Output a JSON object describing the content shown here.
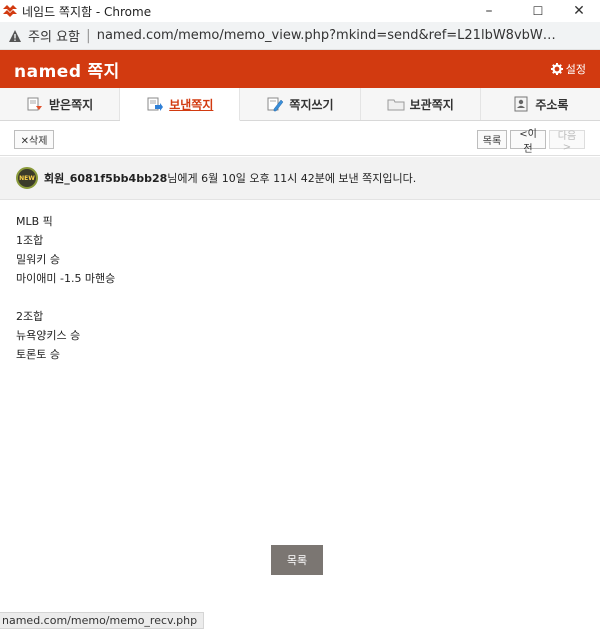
{
  "window": {
    "title": "네임드 쪽지함 - Chrome",
    "minimize": "–",
    "maximize": "☐",
    "close": "✕"
  },
  "addressbar": {
    "warning": "주의 요함",
    "separator": "|",
    "url": "named.com/memo/memo_view.php?mkind=send&ref=L21lbW8vbWVtb19zZW5..."
  },
  "header": {
    "brand": "named",
    "section": "쪽지",
    "settings_label": "설정"
  },
  "tabs": [
    {
      "label": "받은쪽지",
      "icon": "inbox-icon",
      "active": false
    },
    {
      "label": "보낸쪽지",
      "icon": "sent-icon",
      "active": true
    },
    {
      "label": "쪽지쓰기",
      "icon": "compose-icon",
      "active": false
    },
    {
      "label": "보관쪽지",
      "icon": "folder-icon",
      "active": false
    },
    {
      "label": "주소록",
      "icon": "addressbook-icon",
      "active": false
    }
  ],
  "toolbar": {
    "delete_label": "✕삭제",
    "list_label": "목록",
    "prev_label": "<이전",
    "next_label": "다음>"
  },
  "info": {
    "badge": "NEW",
    "recipient": "회원_6081f5bb4bb28",
    "sent_text": "님에게 6월 10일 오후 11시 42분에 보낸 쪽지입니다."
  },
  "message_lines": [
    "MLB 픽",
    "1조합",
    "밀워키 승",
    "마이애미 -1.5 마핸승",
    "",
    "2조합",
    "뉴욕양키스 승",
    "토론토 승"
  ],
  "footer": {
    "list_button": "목록"
  },
  "statusbar": {
    "text": "named.com/memo/memo_recv.php"
  },
  "colors": {
    "accent": "#d23a10",
    "list_button_bg": "#7b7672"
  }
}
